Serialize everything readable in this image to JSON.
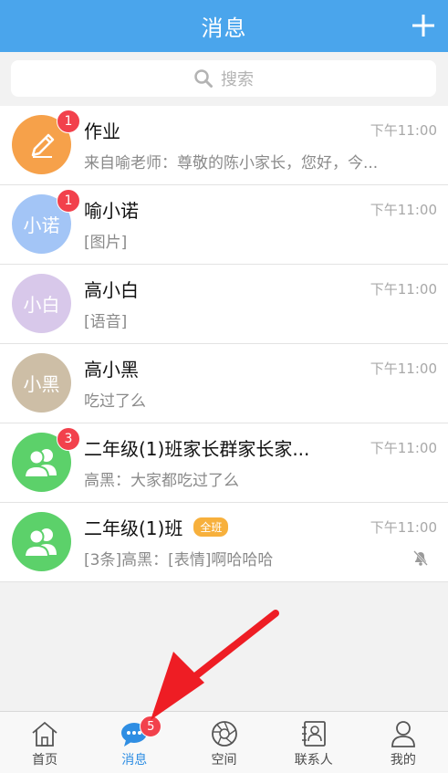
{
  "header": {
    "title": "消息"
  },
  "search": {
    "placeholder": "搜索"
  },
  "conversations": [
    {
      "avatar_text": "",
      "avatar_color": "#f6a14a",
      "badge": "1",
      "name": "作业",
      "tag": "",
      "time": "下午11:00",
      "preview": "来自喻老师：尊敬的陈小家长，您好，今..."
    },
    {
      "avatar_text": "小诺",
      "avatar_color": "#a3c5f6",
      "badge": "1",
      "name": "喻小诺",
      "tag": "",
      "time": "下午11:00",
      "preview": "[图片]"
    },
    {
      "avatar_text": "小白",
      "avatar_color": "#d8c8ea",
      "badge": "",
      "name": "高小白",
      "tag": "",
      "time": "下午11:00",
      "preview": "[语音]"
    },
    {
      "avatar_text": "小黑",
      "avatar_color": "#cdbea6",
      "badge": "",
      "name": "高小黑",
      "tag": "",
      "time": "下午11:00",
      "preview": "吃过了么"
    },
    {
      "avatar_text": "",
      "avatar_color": "#5cd16a",
      "badge": "3",
      "name": "二年级(1)班家长群家长家...",
      "tag": "",
      "time": "下午11:00",
      "preview": "高黑：大家都吃过了么"
    },
    {
      "avatar_text": "",
      "avatar_color": "#5cd16a",
      "badge": "",
      "name": "二年级(1)班",
      "tag": "全班",
      "time": "下午11:00",
      "preview": "[3条]高黑：[表情]啊哈哈哈"
    }
  ],
  "tabs": [
    {
      "label": "首页",
      "icon": "home-icon"
    },
    {
      "label": "消息",
      "icon": "chat-icon",
      "badge": "5",
      "active": true
    },
    {
      "label": "空间",
      "icon": "aperture-icon"
    },
    {
      "label": "联系人",
      "icon": "contacts-icon"
    },
    {
      "label": "我的",
      "icon": "person-icon"
    }
  ],
  "colors": {
    "header": "#4aa5ec",
    "badge": "#f2414c",
    "active_tab": "#2f8ee3",
    "annotation_arrow": "#ee1d24"
  }
}
